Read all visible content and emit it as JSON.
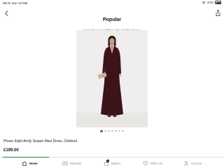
{
  "status_bar": {
    "time": "08:31",
    "date": "Sun 13 Mar",
    "battery_percent": "44%"
  },
  "header": {
    "title": "Popular",
    "subtitle": "5 people viewed this in the last few hours"
  },
  "gallery": {
    "image_count": 7,
    "active_index": 0
  },
  "product": {
    "name": "Phase Eight Amily Sequin Maxi Dress, Oxblood",
    "price": "£199.00"
  },
  "tab_bar": {
    "tabs": [
      {
        "label": "Home",
        "icon": "home-icon",
        "active": true
      },
      {
        "label": "Discover",
        "icon": "discover-icon",
        "active": false
      },
      {
        "label": "Basket",
        "icon": "basket-icon",
        "active": false,
        "badge": "1"
      },
      {
        "label": "Wish List",
        "icon": "heart-icon",
        "active": false
      },
      {
        "label": "Account",
        "icon": "person-icon",
        "active": false
      }
    ],
    "accent_color": "#1a8a3a"
  }
}
